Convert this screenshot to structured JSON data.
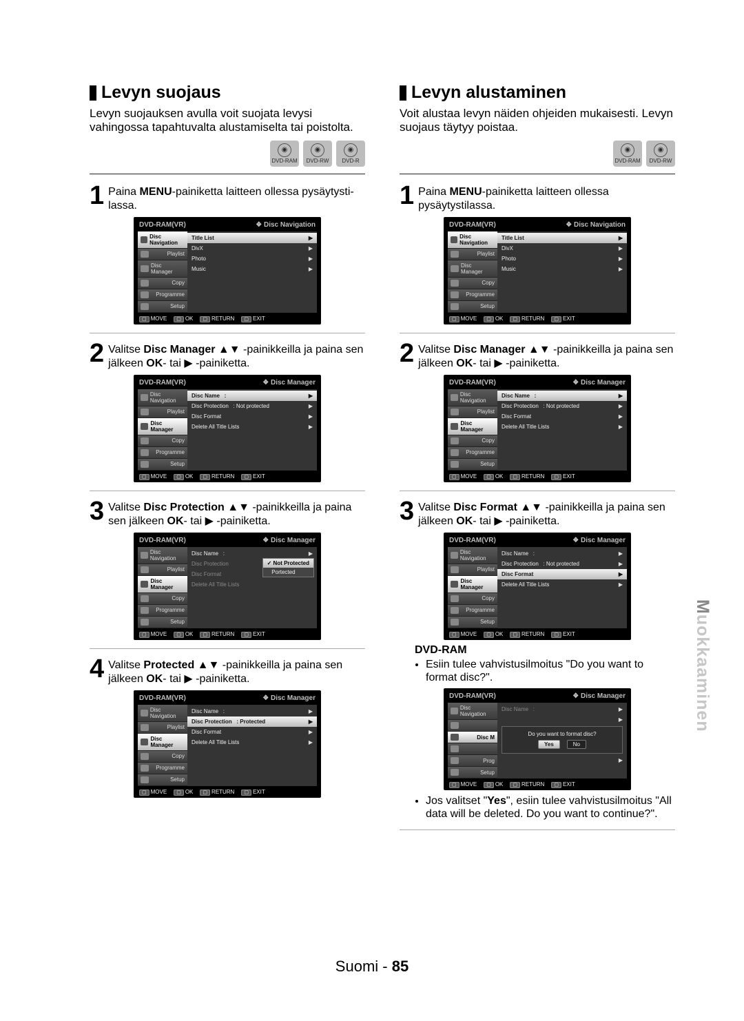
{
  "sidetab_first": "M",
  "sidetab_rest": "uokkaaminen",
  "footer_lang": "Suomi",
  "footer_sep": " - ",
  "footer_page": "85",
  "disc_badges_a": [
    "DVD-RAM",
    "DVD-RW",
    "DVD-R"
  ],
  "disc_badges_b": [
    "DVD-RAM",
    "DVD-RW"
  ],
  "osd_sidebar": [
    "Disc Navigation",
    "Playlist",
    "Disc Manager",
    "Copy",
    "Programme",
    "Setup"
  ],
  "osd_foot": {
    "move": "MOVE",
    "ok": "OK",
    "ret": "RETURN",
    "exit": "EXIT"
  },
  "osd_top_title": "DVD-RAM(VR)",
  "pane_nav_title": "Disc Navigation",
  "pane_nav_items": [
    "Title List",
    "DivX",
    "Photo",
    "Music"
  ],
  "pane_mgr_title": "Disc Manager",
  "mgr_items": {
    "disc_name": "Disc Name",
    "colon": ":",
    "disc_protection": "Disc Protection",
    "np": "Not protected",
    "protected": "Protected",
    "disc_format": "Disc Format",
    "delete_all": "Delete All Title Lists"
  },
  "popup_notprotected": "Not Protected",
  "popup_portected": "Portected",
  "dialog_q": "Do you want to format disc?",
  "btn_yes": "Yes",
  "btn_no": "No",
  "left": {
    "title": "Levyn suojaus",
    "intro": "Levyn suojauksen avulla voit suojata levysi vahingossa tapahtuvalta alustamiselta tai poistolta.",
    "s1_a": "Paina ",
    "s1_b": "MENU",
    "s1_c": "-painiketta laitteen ollessa pysäytysti­lassa.",
    "s2_a": "Valitse ",
    "s2_b": "Disc Manager",
    "s2_c": " ▲▼ -painikkeilla ja paina sen jälkeen ",
    "s2_d": "OK",
    "s2_e": "- tai ▶ -painiketta.",
    "s3_a": "Valitse ",
    "s3_b": "Disc Protection",
    "s3_c": " ▲▼ -painikkeilla ja paina sen jälkeen ",
    "s3_d": "OK",
    "s3_e": "- tai ▶ -painiketta.",
    "s4_a": "Valitse ",
    "s4_b": "Protected",
    "s4_c": " ▲▼ -painikkeilla ja paina sen jälkeen ",
    "s4_d": "OK",
    "s4_e": "- tai ▶ -painiketta."
  },
  "right": {
    "title": "Levyn alustaminen",
    "intro": "Voit alustaa levyn näiden ohjeiden mukaisesti. Levyn suojaus täytyy poistaa.",
    "s1_a": "Paina ",
    "s1_b": "MENU",
    "s1_c": "-painiketta laitteen ollessa pysäytystilassa.",
    "s2_a": "Valitse ",
    "s2_b": "Disc Manager",
    "s2_c": " ▲▼ -painikkeilla ja paina sen jälkeen ",
    "s2_d": "OK",
    "s2_e": "- tai ▶ -painiketta.",
    "s3_a": "Valitse ",
    "s3_b": "Disc Format",
    "s3_c": " ▲▼ -painikkeilla ja paina sen jälkeen ",
    "s3_d": "OK",
    "s3_e": "- tai ▶ -painiketta.",
    "sub": "DVD-RAM",
    "bul1": "Esiin tulee vahvistusilmoitus \"Do you want to format disc?\".",
    "bul2_a": "Jos valitset \"",
    "bul2_b": "Yes",
    "bul2_c": "\", esiin tulee vahvistusilmoitus \"All data will be deleted. Do you want to contin­ue?\"."
  }
}
